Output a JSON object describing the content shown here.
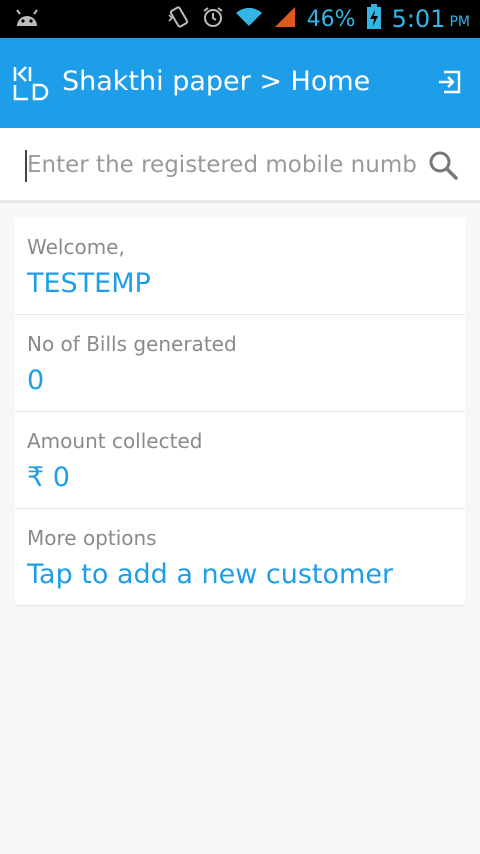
{
  "status_bar": {
    "battery": "46%",
    "time": "5:01",
    "ampm": "PM"
  },
  "app_bar": {
    "title": "Shakthi paper > Home"
  },
  "search": {
    "placeholder": "Enter the registered mobile number",
    "value": ""
  },
  "dashboard": {
    "welcome_label": "Welcome,",
    "welcome_value": "TESTEMP",
    "bills_label": "No of Bills generated",
    "bills_value": "0",
    "amount_label": "Amount collected",
    "amount_value": "₹ 0",
    "options_label": "More options",
    "options_value": "Tap to add a new customer"
  },
  "colors": {
    "primary": "#1e9ee8",
    "status_accent": "#33b5e5",
    "label_gray": "#8a8a8a",
    "background": "#f7f7f7"
  },
  "icons": [
    "android-icon",
    "vibrate-icon",
    "alarm-icon",
    "wifi-icon",
    "signal-icon",
    "battery-charging-icon",
    "app-logo-icon",
    "exit-icon",
    "search-icon"
  ]
}
